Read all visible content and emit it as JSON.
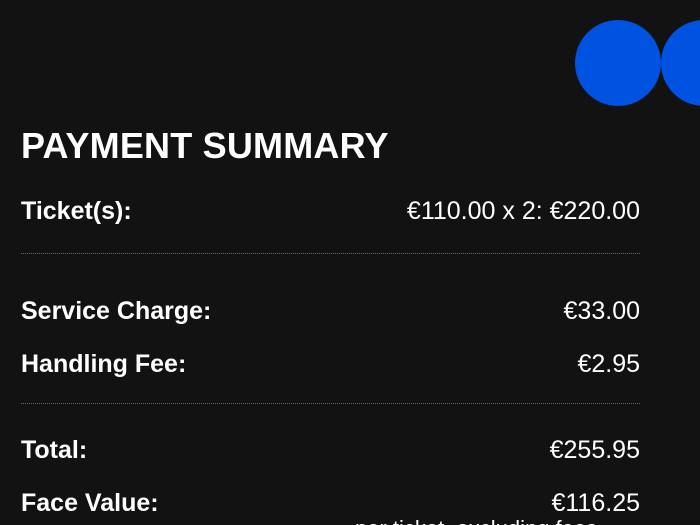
{
  "colors": {
    "background": "#121212",
    "text": "#ffffff",
    "accent": "#0052e0",
    "separator": "#6a6a6a"
  },
  "summary": {
    "title": "PAYMENT SUMMARY",
    "tickets": {
      "label": "Ticket(s):",
      "value": "€110.00 x 2: €220.00"
    },
    "service_charge": {
      "label": "Service Charge:",
      "value": "€33.00"
    },
    "handling_fee": {
      "label": "Handling Fee:",
      "value": "€2.95"
    },
    "total": {
      "label": "Total:",
      "value": "€255.95"
    },
    "face_value": {
      "label": "Face Value:",
      "value": "€116.25"
    },
    "footnote": "per ticket, excluding fees"
  }
}
